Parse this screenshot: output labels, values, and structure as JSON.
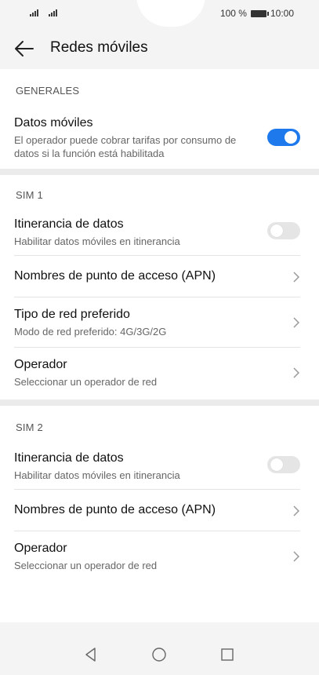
{
  "status_bar": {
    "battery_percent": "100 %",
    "time": "10:00"
  },
  "header": {
    "title": "Redes móviles",
    "back_icon": "arrow-left-icon"
  },
  "sections": {
    "general": {
      "label": "GENERALES",
      "mobile_data": {
        "title": "Datos móviles",
        "subtitle": "El operador puede cobrar tarifas por consumo de datos si la función está habilitada",
        "enabled": true
      }
    },
    "sim1": {
      "label": "SIM 1",
      "roaming": {
        "title": "Itinerancia de datos",
        "subtitle": "Habilitar datos móviles en itinerancia",
        "enabled": false
      },
      "apn": {
        "title": "Nombres de punto de acceso (APN)"
      },
      "network_type": {
        "title": "Tipo de red preferido",
        "subtitle": "Modo de red preferido: 4G/3G/2G"
      },
      "operator": {
        "title": "Operador",
        "subtitle": "Seleccionar un operador de red"
      }
    },
    "sim2": {
      "label": "SIM 2",
      "roaming": {
        "title": "Itinerancia de datos",
        "subtitle": "Habilitar datos móviles en itinerancia",
        "enabled": false
      },
      "apn": {
        "title": "Nombres de punto de acceso (APN)"
      },
      "operator": {
        "title": "Operador",
        "subtitle": "Seleccionar un operador de red"
      }
    }
  },
  "colors": {
    "accent": "#1e7aec",
    "background": "#f4f4f4",
    "card": "#ffffff"
  },
  "navbar": {
    "icons": [
      "back-triangle-icon",
      "home-circle-icon",
      "recents-square-icon"
    ]
  }
}
